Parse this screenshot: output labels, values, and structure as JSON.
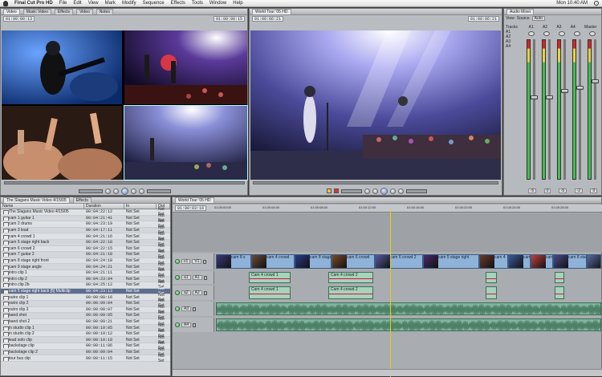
{
  "menubar": {
    "app_name": "Final Cut Pro HD",
    "items": [
      "File",
      "Edit",
      "View",
      "Mark",
      "Modify",
      "Sequence",
      "Effects",
      "Tools",
      "Window",
      "Help"
    ],
    "clock": "Mon 10:40 AM"
  },
  "browser_tabs": [
    "Video",
    "Music Video",
    "Effects",
    "Video",
    "Notes"
  ],
  "viewer": {
    "tab": "Video",
    "timecode_left": "01:00:00:13",
    "timecode_right": "01:00:00:15"
  },
  "canvas": {
    "title": "World Tour '05 HD",
    "timecode_left": "01:00:06:21",
    "timecode_right": "01:00:06:21"
  },
  "audio_mixer": {
    "title": "Audio Mixer",
    "tracks_label": "Tracks",
    "view_label": "View",
    "source_label": "Source",
    "source_value": "Auto",
    "track_list": [
      "A1",
      "A2",
      "A3",
      "A4"
    ],
    "channels": [
      "A1",
      "A2",
      "A3",
      "A4"
    ],
    "master_label": "Master",
    "levels": [
      -5,
      -5,
      -3,
      -2
    ],
    "level_text": [
      "-5",
      "0",
      "-5",
      "-2",
      "0"
    ]
  },
  "browser": {
    "tabs": [
      "The Slagans Music Video 4/15/05",
      "Effects"
    ],
    "columns": [
      "Name",
      "Duration",
      "In",
      "Out"
    ],
    "rows": [
      {
        "name": "The Slagans Music Video 4/15/05",
        "duration": "00:04:22:12",
        "in": "Not Set",
        "out": "Not Set"
      },
      {
        "name": "cam 1 guitar 1",
        "duration": "00:04:21:41",
        "in": "Not Set",
        "out": "Not Set"
      },
      {
        "name": "cam 2 drums",
        "duration": "00:04:23:19",
        "in": "Not Set",
        "out": "Not Set"
      },
      {
        "name": "cam 3 lead",
        "duration": "00:04:17:11",
        "in": "Not Set",
        "out": "Not Set"
      },
      {
        "name": "cam 4 crowd 1",
        "duration": "00:04:21:16",
        "in": "Not Set",
        "out": "Not Set"
      },
      {
        "name": "cam 5 stage right back",
        "duration": "00:04:22:18",
        "in": "Not Set",
        "out": "Not Set"
      },
      {
        "name": "cam 6 crowd 2",
        "duration": "00:04:22:15",
        "in": "Not Set",
        "out": "Not Set"
      },
      {
        "name": "cam 7 guitar 2",
        "duration": "00:04:21:18",
        "in": "Not Set",
        "out": "Not Set"
      },
      {
        "name": "cam 8 stage right front",
        "duration": "00:04:24:18",
        "in": "Not Set",
        "out": "Not Set"
      },
      {
        "name": "cam 9 stage angle",
        "duration": "00:04:24:21",
        "in": "Not Set",
        "out": "Not Set"
      },
      {
        "name": "intro clip 1",
        "duration": "00:04:21:11",
        "in": "Not Set",
        "out": "Not Set"
      },
      {
        "name": "intro clip 2",
        "duration": "00:04:23:04",
        "in": "Not Set",
        "out": "Not Set"
      },
      {
        "name": "intro clip 2b",
        "duration": "00:04:25:12",
        "in": "Not Set",
        "out": "Not Set"
      },
      {
        "name": "cam 5 stage right back [5] Multiclip",
        "duration": "00:04:23:13",
        "in": "Not Set",
        "out": "Not Set",
        "selected": true
      },
      {
        "name": "outro clip 1",
        "duration": "00:00:08:16",
        "in": "Not Set",
        "out": "Not Set"
      },
      {
        "name": "outro clip 2",
        "duration": "00:00:09:04",
        "in": "Not Set",
        "out": "Not Set"
      },
      {
        "name": "outro clip 3",
        "duration": "00:00:08:07",
        "in": "Not Set",
        "out": "Not Set"
      },
      {
        "name": "band shot",
        "duration": "00:00:09:05",
        "in": "Not Set",
        "out": "Not Set"
      },
      {
        "name": "band shot 2",
        "duration": "00:00:09:21",
        "in": "Not Set",
        "out": "Not Set"
      },
      {
        "name": "in studio clip 1",
        "duration": "00:00:19:05",
        "in": "Not Set",
        "out": "Not Set"
      },
      {
        "name": "in studio clip 2",
        "duration": "00:00:19:12",
        "in": "Not Set",
        "out": "Not Set"
      },
      {
        "name": "lead solo clip",
        "duration": "00:00:10:18",
        "in": "Not Set",
        "out": "Not Set"
      },
      {
        "name": "backstage clip",
        "duration": "00:00:11:06",
        "in": "Not Set",
        "out": "Not Set"
      },
      {
        "name": "backstage clip 2",
        "duration": "00:00:09:04",
        "in": "Not Set",
        "out": "Not Set"
      },
      {
        "name": "tour bus clip",
        "duration": "00:00:11:15",
        "in": "Not Set",
        "out": "Not Set"
      }
    ]
  },
  "timeline": {
    "tab": "World Tour '05 HD",
    "timecode": "01:00:03:16",
    "ruler": [
      "01:00:00:00",
      "01:00:04:00",
      "01:00:08:00",
      "01:00:12:00",
      "01:00:16:00",
      "01:00:20:00",
      "01:00:24:00",
      "01:00:28:00"
    ],
    "video_track": {
      "head": "V1",
      "patch": "v1",
      "clips": [
        "cam 8 s",
        "cam 4 crowd",
        "cam 8 stage",
        "cam 6 crowd",
        "cam 6 crowd 2",
        "cam 5 stage right",
        "cam 4",
        "cam 6",
        "cam 2",
        "cam 8 stage",
        "cam"
      ]
    },
    "audio_tracks": [
      {
        "head": "A1",
        "patch": "a1",
        "clips": [
          "Cam 4 crowd 1",
          "Cam 4 crowd 2"
        ]
      },
      {
        "head": "A2",
        "patch": "a2",
        "clips": [
          "Cam 4 crowd 1",
          "Cam 4 crowd 2"
        ]
      },
      {
        "head": "A3",
        "patch": "",
        "clips": []
      },
      {
        "head": "A4",
        "patch": "",
        "clips": []
      }
    ]
  },
  "colors": {
    "accent": "#5d6e8e",
    "video_clip": "#8fb2d8",
    "audio_clip": "#a7d3bb",
    "waveform": "#7fb59b"
  }
}
